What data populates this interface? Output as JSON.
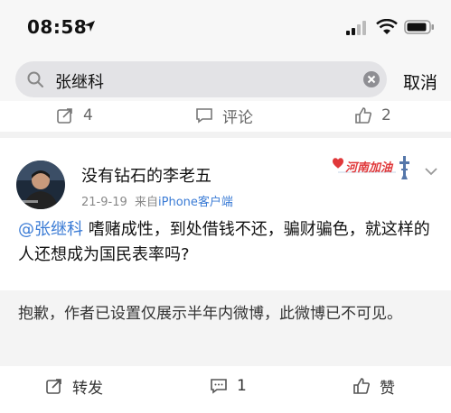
{
  "status": {
    "time": "08:58"
  },
  "search": {
    "query": "张继科",
    "cancel_label": "取消"
  },
  "prev_post_actions": {
    "repost_count": "4",
    "comment_label": "评论",
    "like_count": "2"
  },
  "post": {
    "username": "没有钻石的李老五",
    "date": "21-9-19",
    "source_prefix": "来自",
    "source": "iPhone客户端",
    "badge": "河南加油",
    "mention": "@张继科",
    "text": " 嗜赌成性，到处借钱不还，骗财骗色，就这样的人还想成为国民表率吗?",
    "notice": "抱歉，作者已设置仅展示半年内微博，此微博已不可见。",
    "actions": {
      "repost_label": "转发",
      "comment_count": "1",
      "like_label": "赞"
    }
  },
  "icons": [
    "location-arrow-icon",
    "signal-icon",
    "wifi-icon",
    "battery-icon",
    "search-icon",
    "clear-icon",
    "repost-icon",
    "comment-icon",
    "like-icon",
    "chevron-down-icon"
  ],
  "colors": {
    "link": "#3a7bd5",
    "background": "#f2f2f2",
    "badge_red": "#e0383a"
  }
}
